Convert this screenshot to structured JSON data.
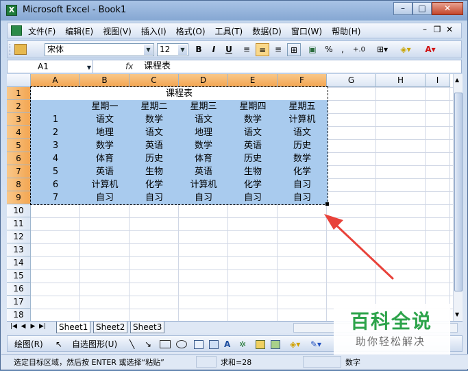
{
  "window": {
    "title": "Microsoft Excel - Book1"
  },
  "menu": {
    "items": [
      "文件(F)",
      "编辑(E)",
      "视图(V)",
      "插入(I)",
      "格式(O)",
      "工具(T)",
      "数据(D)",
      "窗口(W)",
      "帮助(H)"
    ]
  },
  "toolbar": {
    "font_name": "宋体",
    "font_size": "12",
    "bold": "B",
    "italic": "I",
    "underline": "U",
    "percent": "%",
    "comma": ",",
    "decimals": "+.0",
    "aligned": "center"
  },
  "formula_bar": {
    "name_box": "A1",
    "fx": "fx",
    "value": "课程表"
  },
  "sheet": {
    "columns": [
      "A",
      "B",
      "C",
      "D",
      "E",
      "F",
      "G",
      "H",
      "I"
    ],
    "rows": [
      "1",
      "2",
      "3",
      "4",
      "5",
      "6",
      "7",
      "8",
      "9",
      "10",
      "11",
      "12",
      "13",
      "14",
      "15",
      "16",
      "17",
      "18"
    ],
    "title": "课程表",
    "header": [
      "",
      "星期一",
      "星期二",
      "星期三",
      "星期四",
      "星期五"
    ],
    "data": [
      [
        "1",
        "语文",
        "数学",
        "语文",
        "数学",
        "计算机"
      ],
      [
        "2",
        "地理",
        "语文",
        "地理",
        "语文",
        "语文"
      ],
      [
        "3",
        "数学",
        "英语",
        "数学",
        "英语",
        "历史"
      ],
      [
        "4",
        "体育",
        "历史",
        "体育",
        "历史",
        "数学"
      ],
      [
        "5",
        "英语",
        "生物",
        "英语",
        "生物",
        "化学"
      ],
      [
        "6",
        "计算机",
        "化学",
        "计算机",
        "化学",
        "自习"
      ],
      [
        "7",
        "自习",
        "自习",
        "自习",
        "自习",
        "自习"
      ]
    ]
  },
  "tabs": [
    "Sheet1",
    "Sheet2",
    "Sheet3"
  ],
  "draw_toolbar": {
    "draw": "绘图(R)",
    "autoshapes": "自选图形(U)"
  },
  "status": {
    "message": "选定目标区域，然后按 ENTER 或选择“粘贴”",
    "sum": "求和=28",
    "mode": "数字"
  },
  "watermark": {
    "title": "百科全说",
    "subtitle": "助你轻松解决"
  },
  "colors": {
    "selection": "#a9cbee",
    "header_selected": "#f3a652",
    "arrow": "#e8423a",
    "brand_green": "#2ca34a"
  }
}
